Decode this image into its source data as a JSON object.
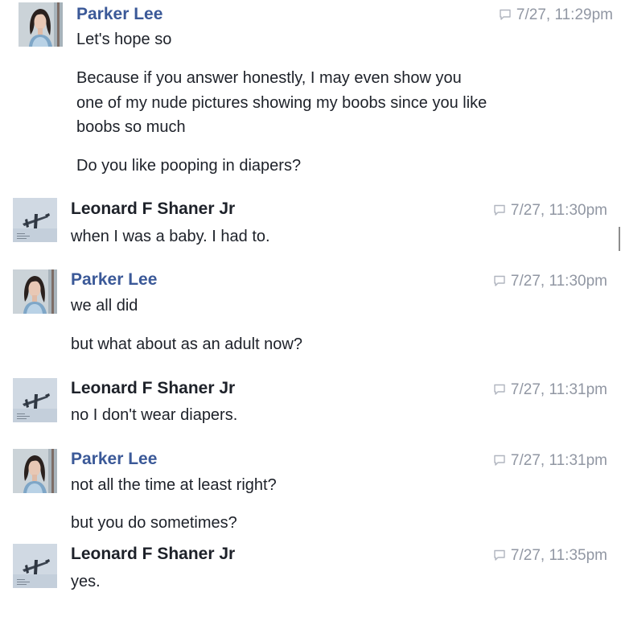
{
  "colors": {
    "name_female": "#3b5998",
    "name_male": "#1d2129",
    "timestamp": "#9197a3",
    "message_text": "#1d2129"
  },
  "icons": {
    "timestamp": "chat-bubble-icon",
    "avatar_parker": "avatar-woman-photo",
    "avatar_leonard": "avatar-airplane-photo"
  },
  "messages": [
    {
      "sender": "Parker Lee",
      "time": "7/27, 11:29pm",
      "lines": [
        "Let's hope so",
        "Because if you answer honestly, I may even show you",
        "one of my nude pictures showing my boobs since you like",
        "boobs so much",
        "Do you like pooping in diapers?"
      ]
    },
    {
      "sender": "Leonard F Shaner Jr",
      "time": "7/27, 11:30pm",
      "lines": [
        "when I was a baby. I had to."
      ]
    },
    {
      "sender": "Parker Lee",
      "time": "7/27, 11:30pm",
      "lines": [
        "we all did",
        "but what about as an adult now?"
      ]
    },
    {
      "sender": "Leonard F Shaner Jr",
      "time": "7/27, 11:31pm",
      "lines": [
        "no I don't wear diapers."
      ]
    },
    {
      "sender": "Parker Lee",
      "time": "7/27, 11:31pm",
      "lines": [
        "not all the time at least right?",
        "but you do sometimes?"
      ]
    },
    {
      "sender": "Leonard F Shaner Jr",
      "time": "7/27, 11:35pm",
      "lines": [
        "yes."
      ]
    }
  ]
}
